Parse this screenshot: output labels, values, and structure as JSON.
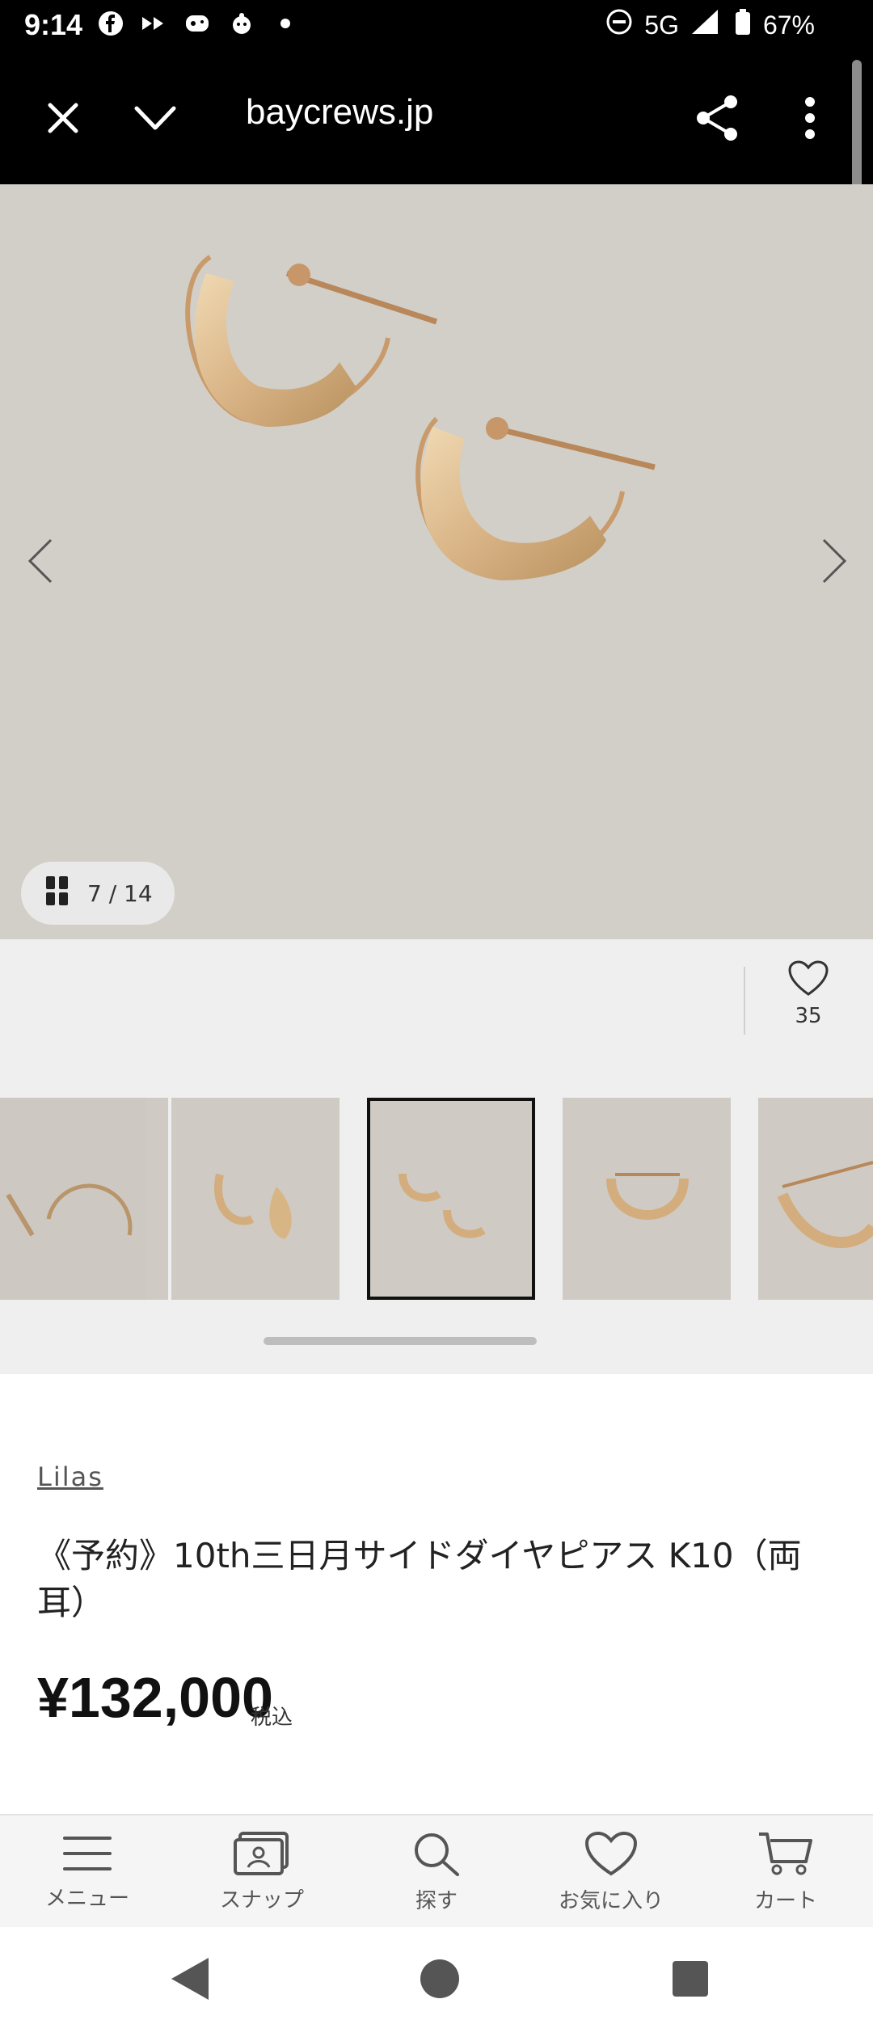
{
  "status_bar": {
    "time": "9:14",
    "network": "5G",
    "battery": "67%"
  },
  "browser": {
    "url": "baycrews.jp"
  },
  "gallery": {
    "counter": "7 / 14"
  },
  "favorite": {
    "count": "35"
  },
  "product": {
    "brand": "Lilas",
    "title": "《予約》10th三日月サイドダイヤピアス K10（両耳）",
    "price": "¥132,000",
    "tax_label": "税込"
  },
  "bottom_nav": {
    "items": [
      {
        "label": "メニュー",
        "icon": "menu-icon"
      },
      {
        "label": "スナップ",
        "icon": "snap-icon"
      },
      {
        "label": "探す",
        "icon": "search-icon"
      },
      {
        "label": "お気に入り",
        "icon": "heart-icon"
      },
      {
        "label": "カート",
        "icon": "cart-icon"
      }
    ]
  },
  "colors": {
    "gold": "#d9b98c",
    "image_bg": "#cfccc6",
    "panel_bg": "#efefef"
  }
}
